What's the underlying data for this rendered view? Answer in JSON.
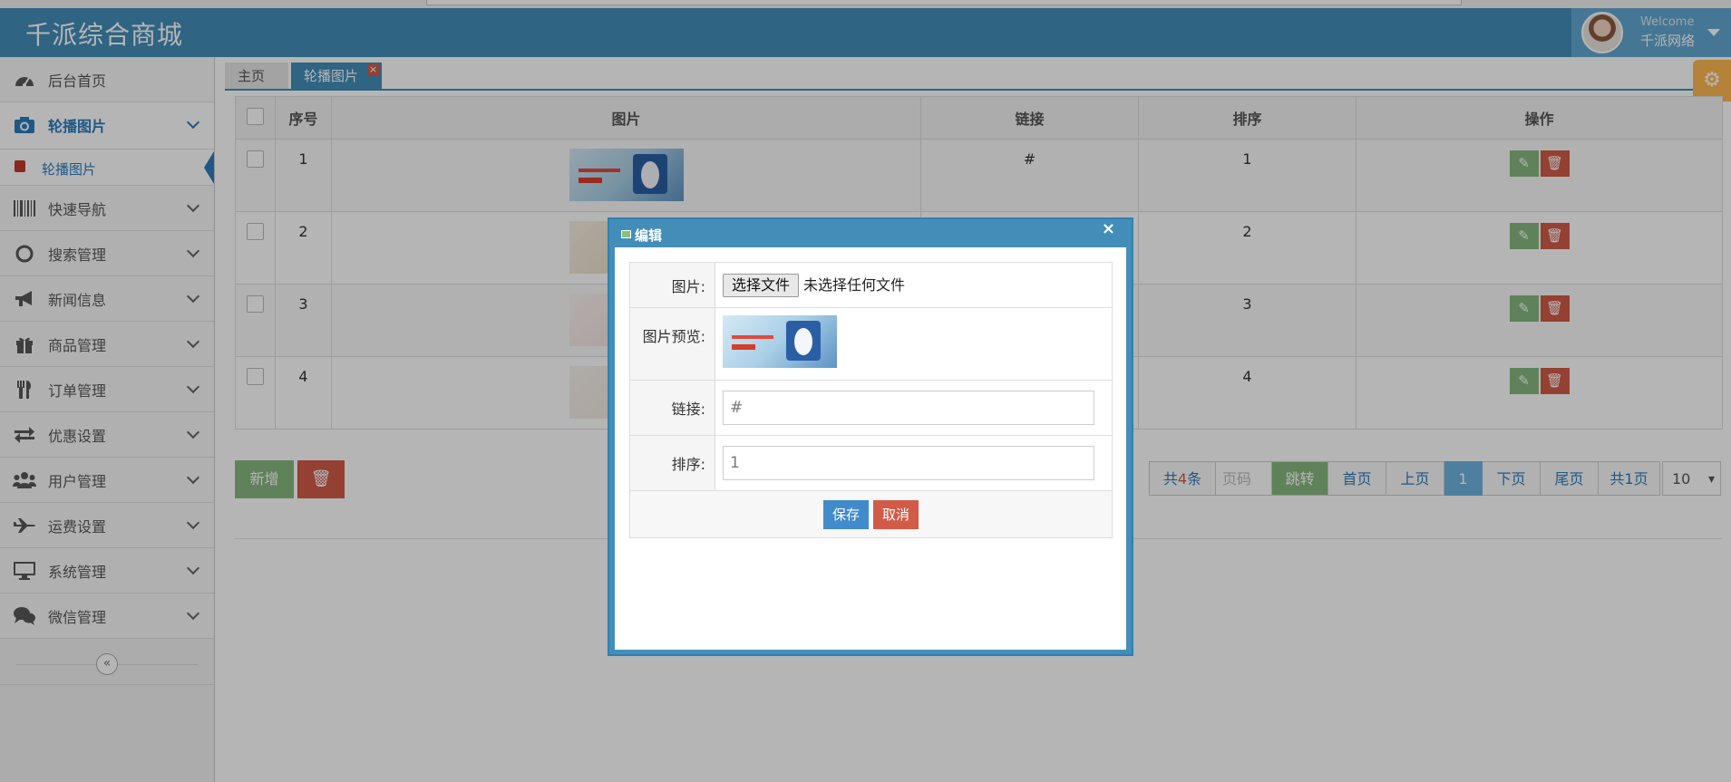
{
  "header": {
    "app_title": "千派综合商城",
    "welcome": "Welcome",
    "username": "千派网络"
  },
  "sidebar": {
    "items": [
      {
        "label": "后台首页",
        "icon": "dashboard-icon"
      },
      {
        "label": "轮播图片",
        "icon": "camera-icon",
        "active": true
      },
      {
        "label": "快速导航",
        "icon": "barcode-icon"
      },
      {
        "label": "搜索管理",
        "icon": "circle-icon"
      },
      {
        "label": "新闻信息",
        "icon": "bullhorn-icon"
      },
      {
        "label": "商品管理",
        "icon": "gift-icon"
      },
      {
        "label": "订单管理",
        "icon": "cutlery-icon"
      },
      {
        "label": "优惠设置",
        "icon": "exchange-icon"
      },
      {
        "label": "用户管理",
        "icon": "users-icon"
      },
      {
        "label": "运费设置",
        "icon": "plane-icon"
      },
      {
        "label": "系统管理",
        "icon": "desktop-icon"
      },
      {
        "label": "微信管理",
        "icon": "comments-icon"
      }
    ],
    "submenu": {
      "label": "轮播图片",
      "icon": "gift-icon"
    }
  },
  "tabs": [
    {
      "label": "主页"
    },
    {
      "label": "轮播图片",
      "active": true
    }
  ],
  "table": {
    "headers": [
      "",
      "序号",
      "图片",
      "链接",
      "排序",
      "操作"
    ],
    "rows": [
      {
        "index": "1",
        "link": "#",
        "sort": "1"
      },
      {
        "index": "2",
        "link": "",
        "sort": "2"
      },
      {
        "index": "3",
        "link": "",
        "sort": "3"
      },
      {
        "index": "4",
        "link": "",
        "sort": "4"
      }
    ]
  },
  "actions": {
    "add_label": "新增"
  },
  "pagination": {
    "total_prefix": "共",
    "total_count": "4",
    "total_suffix": "条",
    "page_input_placeholder": "页码",
    "jump_label": "跳转",
    "first_label": "首页",
    "prev_label": "上页",
    "current_page": "1",
    "next_label": "下页",
    "last_label": "尾页",
    "pages_label": "共1页",
    "page_size": "10"
  },
  "modal": {
    "title": "编辑",
    "image_label": "图片:",
    "file_button": "选择文件",
    "file_status": "未选择任何文件",
    "preview_label": "图片预览:",
    "link_label": "链接:",
    "link_value": "#",
    "sort_label": "排序:",
    "sort_value": "1",
    "save_label": "保存",
    "cancel_label": "取消"
  },
  "colors": {
    "topbar": "#438eb9",
    "accent": "#2b7dbc",
    "success": "#87b87f",
    "danger": "#d15b47"
  }
}
